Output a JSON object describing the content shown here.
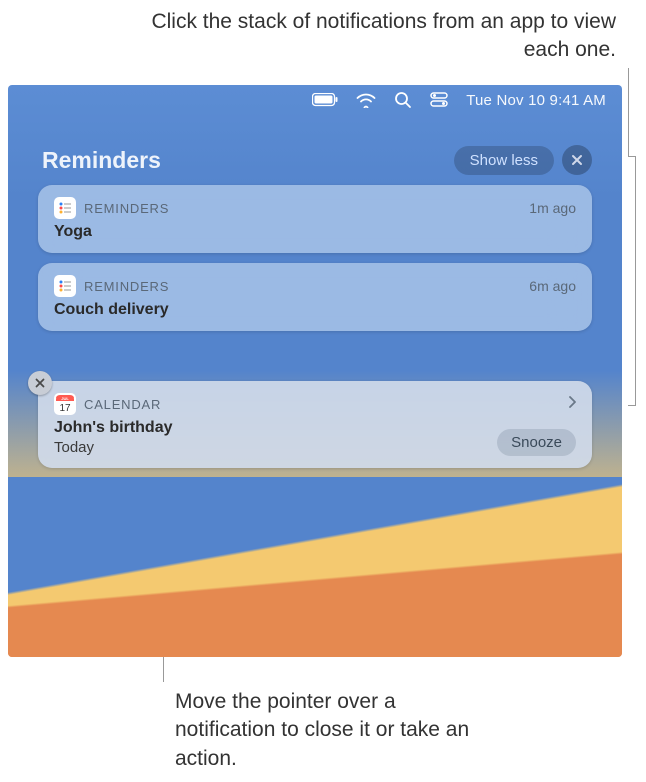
{
  "annotations": {
    "top": "Click the stack of notifications from an app to view each one.",
    "bottom": "Move the pointer over a notification to close it or take an action."
  },
  "menubar": {
    "datetime": "Tue Nov 10  9:41 AM"
  },
  "group": {
    "title": "Reminders",
    "show_less": "Show less"
  },
  "notifications": [
    {
      "app": "REMINDERS",
      "time": "1m ago",
      "title": "Yoga"
    },
    {
      "app": "REMINDERS",
      "time": "6m ago",
      "title": "Couch delivery"
    }
  ],
  "calendar_notification": {
    "app": "CALENDAR",
    "title": "John's birthday",
    "subtitle": "Today",
    "snooze": "Snooze"
  }
}
